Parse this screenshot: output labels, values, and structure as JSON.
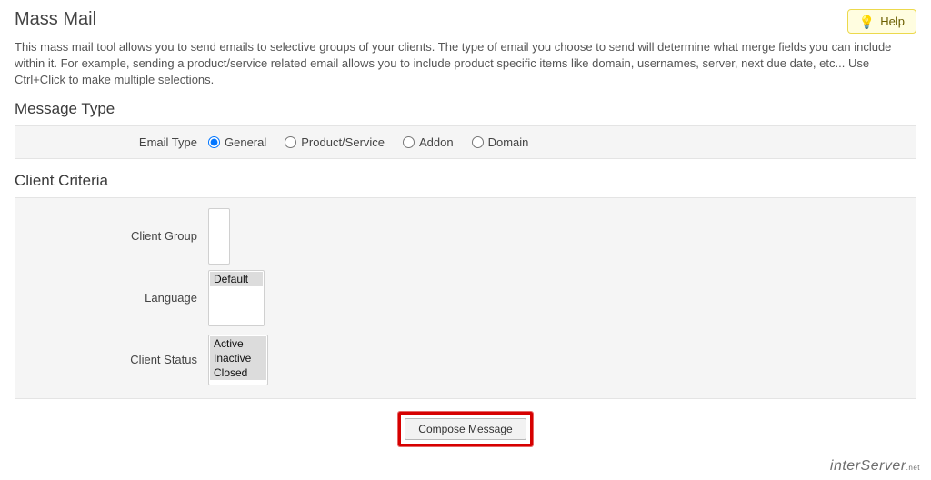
{
  "header": {
    "title": "Mass Mail",
    "help_label": "Help"
  },
  "description": "This mass mail tool allows you to send emails to selective groups of your clients. The type of email you choose to send will determine what merge fields you can include within it. For example, sending a product/service related email allows you to include product specific items like domain, usernames, server, next due date, etc... Use Ctrl+Click to make multiple selections.",
  "message_type": {
    "section_title": "Message Type",
    "label": "Email Type",
    "options": {
      "general": "General",
      "product_service": "Product/Service",
      "addon": "Addon",
      "domain": "Domain"
    },
    "selected": "general"
  },
  "client_criteria": {
    "section_title": "Client Criteria",
    "client_group": {
      "label": "Client Group",
      "options": []
    },
    "language": {
      "label": "Language",
      "options": [
        "Default"
      ]
    },
    "client_status": {
      "label": "Client Status",
      "options": [
        "Active",
        "Inactive",
        "Closed"
      ]
    }
  },
  "compose": {
    "label": "Compose Message"
  },
  "branding": "interServer",
  "branding_suffix": ".net"
}
